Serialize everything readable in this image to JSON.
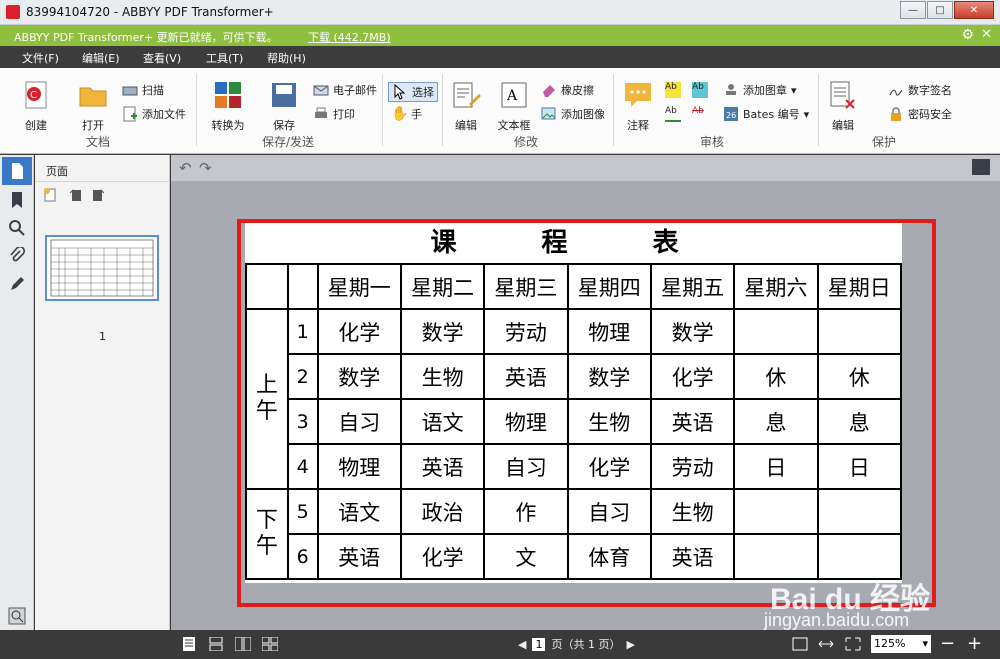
{
  "window": {
    "title": "83994104720 - ABBYY PDF Transformer+"
  },
  "notification": {
    "message": "ABBYY PDF Transformer+ 更新已就绪，可供下载。",
    "download_label": "下载 (442.7MB)"
  },
  "menu": [
    "文件(F)",
    "编辑(E)",
    "查看(V)",
    "工具(T)",
    "帮助(H)"
  ],
  "ribbon": {
    "create": "创建",
    "open": "打开",
    "scan": "扫描",
    "add_file": "添加文件",
    "group_doc": "文档",
    "convert": "转换为",
    "save": "保存",
    "email": "电子邮件",
    "print": "打印",
    "group_save": "保存/发送",
    "select": "选择",
    "hand": "手",
    "edit": "编辑",
    "textbox": "文本框",
    "eraser": "橡皮擦",
    "add_image": "添加图像",
    "group_modify": "修改",
    "comment": "注释",
    "add_stamp": "添加图章",
    "bates": "Bates 编号",
    "group_review": "审核",
    "edit2": "编辑",
    "digital_sign": "数字签名",
    "password": "密码安全",
    "group_protect": "保护"
  },
  "pages_panel": {
    "title": "页面",
    "page_number": "1"
  },
  "document": {
    "title": "课 程 表",
    "days": [
      "星期一",
      "星期二",
      "星期三",
      "星期四",
      "星期五",
      "星期六",
      "星期日"
    ],
    "morning": "上午",
    "afternoon": "下午",
    "rows": [
      {
        "n": "1",
        "cells": [
          "化学",
          "数学",
          "劳动",
          "物理",
          "数学"
        ]
      },
      {
        "n": "2",
        "cells": [
          "数学",
          "生物",
          "英语",
          "数学",
          "化学"
        ]
      },
      {
        "n": "3",
        "cells": [
          "自习",
          "语文",
          "物理",
          "生物",
          "英语"
        ]
      },
      {
        "n": "4",
        "cells": [
          "物理",
          "英语",
          "自习",
          "化学",
          "劳动"
        ]
      },
      {
        "n": "5",
        "cells": [
          "语文",
          "政治",
          "作",
          "自习",
          "生物"
        ]
      },
      {
        "n": "6",
        "cells": [
          "英语",
          "化学",
          "文",
          "体育",
          "英语"
        ]
      }
    ],
    "weekend": [
      "休",
      "息",
      "日"
    ]
  },
  "status": {
    "page_current": "1",
    "page_of": "页（共 1 页）",
    "zoom": "125%"
  },
  "watermark": {
    "brand": "Bai du 经验",
    "url": "jingyan.baidu.com"
  }
}
